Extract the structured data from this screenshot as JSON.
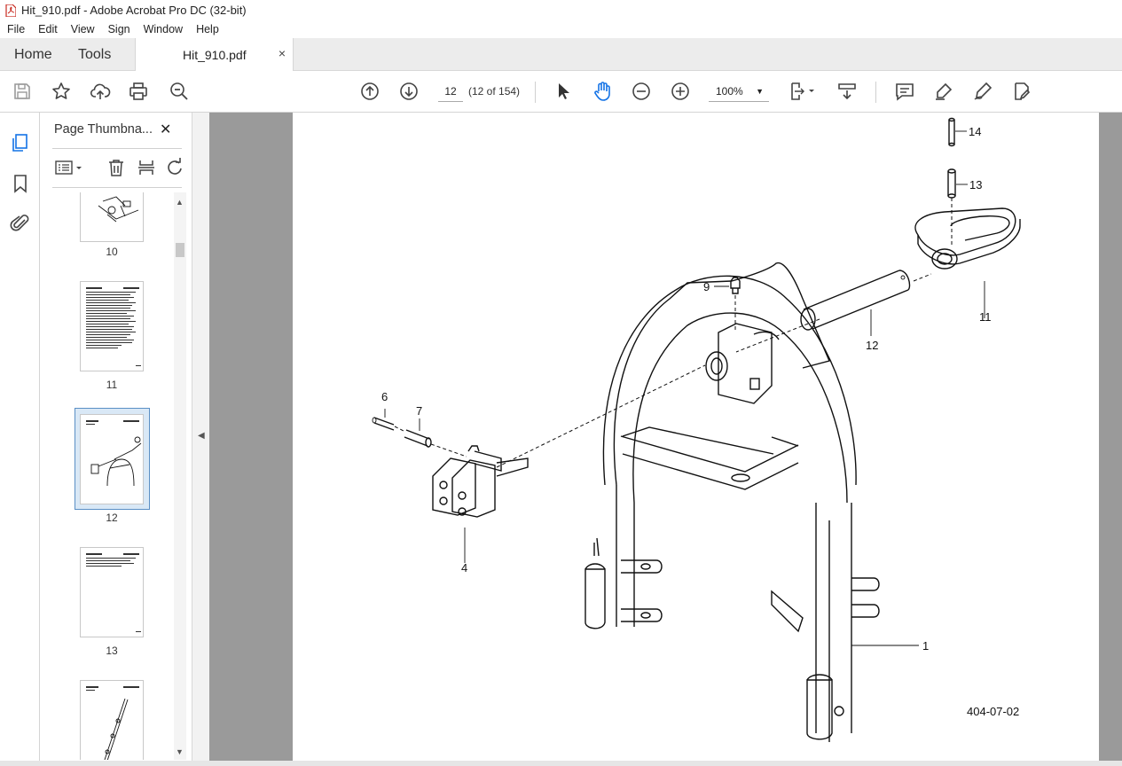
{
  "window": {
    "title": "Hit_910.pdf - Adobe Acrobat Pro DC (32-bit)"
  },
  "menu": [
    "File",
    "Edit",
    "View",
    "Sign",
    "Window",
    "Help"
  ],
  "tabs": {
    "home": "Home",
    "tools": "Tools",
    "document": "Hit_910.pdf",
    "close": "×"
  },
  "toolbar": {
    "page_current": "12",
    "page_count": "(12 of 154)",
    "zoom": "100%",
    "icons": [
      "save-icon",
      "star-icon",
      "upload-icon",
      "print-icon",
      "zoom-search-icon",
      "page-up-icon",
      "page-down-icon",
      "select-cursor-icon",
      "hand-icon",
      "zoom-out-icon",
      "zoom-in-icon",
      "fit-page-icon",
      "scroll-mode-icon",
      "comment-icon",
      "highlight-icon",
      "sign-icon",
      "edit-pdf-icon"
    ]
  },
  "sidebar": {
    "panel_title": "Page Thumbna...",
    "close": "✕",
    "thumbnails": [
      {
        "label": "10"
      },
      {
        "label": "11"
      },
      {
        "label": "12",
        "selected": true
      },
      {
        "label": "13"
      },
      {
        "label": ""
      }
    ]
  },
  "document": {
    "callouts": {
      "c14": "14",
      "c13": "13",
      "c11": "11",
      "c12": "12",
      "c9": "9",
      "c6": "6",
      "c7": "7",
      "c4": "4",
      "c1": "1"
    },
    "figure_id": "404-07-02"
  },
  "colors": {
    "accent": "#1473e6",
    "selection": "#d9e8f6",
    "canvas": "#9a9a9a"
  }
}
